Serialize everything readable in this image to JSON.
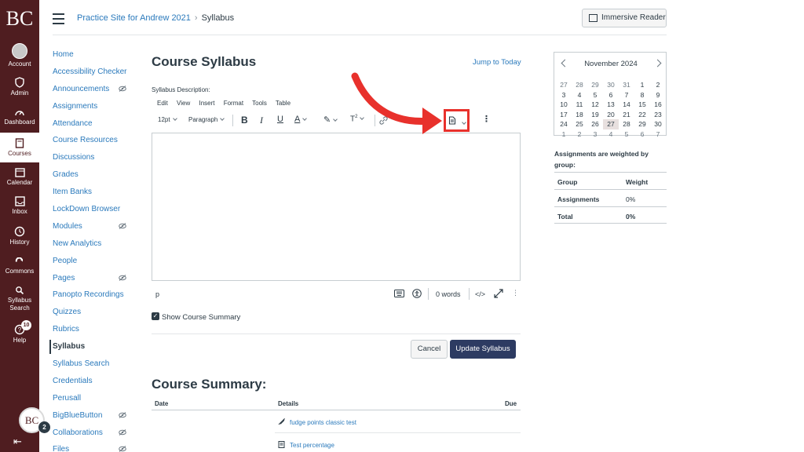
{
  "global_nav": {
    "logo": "BC",
    "items": [
      {
        "label": "Account"
      },
      {
        "label": "Admin"
      },
      {
        "label": "Dashboard"
      },
      {
        "label": "Courses"
      },
      {
        "label": "Calendar"
      },
      {
        "label": "Inbox"
      },
      {
        "label": "History"
      },
      {
        "label": "Commons"
      },
      {
        "label": "Syllabus Search"
      },
      {
        "label": "Help"
      }
    ],
    "help_badge": "10",
    "avatar_initials": "BC",
    "avatar_badge": "2"
  },
  "header": {
    "crumb_course": "Practice Site for Andrew 2021",
    "crumb_current": "Syllabus",
    "immersive_reader": "Immersive Reader"
  },
  "course_nav": [
    {
      "label": "Home"
    },
    {
      "label": "Accessibility Checker"
    },
    {
      "label": "Announcements"
    },
    {
      "label": "Assignments"
    },
    {
      "label": "Attendance"
    },
    {
      "label": "Course Resources"
    },
    {
      "label": "Discussions"
    },
    {
      "label": "Grades"
    },
    {
      "label": "Item Banks"
    },
    {
      "label": "LockDown Browser"
    },
    {
      "label": "Modules"
    },
    {
      "label": "New Analytics"
    },
    {
      "label": "People"
    },
    {
      "label": "Pages"
    },
    {
      "label": "Panopto Recordings"
    },
    {
      "label": "Quizzes"
    },
    {
      "label": "Rubrics"
    },
    {
      "label": "Syllabus"
    },
    {
      "label": "Syllabus Search"
    },
    {
      "label": "Credentials"
    },
    {
      "label": "Perusall"
    },
    {
      "label": "BigBlueButton"
    },
    {
      "label": "Collaborations"
    },
    {
      "label": "Files"
    }
  ],
  "main": {
    "title": "Course Syllabus",
    "jump_link": "Jump to Today",
    "description_label": "Syllabus Description:",
    "menubar": [
      "Edit",
      "View",
      "Insert",
      "Format",
      "Tools",
      "Table"
    ],
    "font_size": "12pt",
    "block_format": "Paragraph",
    "status_path": "p",
    "word_count": "0 words",
    "html_toggle": "</>",
    "show_summary_label": "Show Course Summary",
    "cancel_label": "Cancel",
    "update_label": "Update Syllabus",
    "summary_title": "Course Summary:",
    "summary_headers": {
      "date": "Date",
      "details": "Details",
      "due": "Due"
    },
    "summary_rows": [
      {
        "title": "fudge points classic test"
      },
      {
        "title": "Test percentage"
      }
    ]
  },
  "calendar": {
    "title": "November 2024",
    "weeks": [
      [
        "27",
        "28",
        "29",
        "30",
        "31",
        "1",
        "2"
      ],
      [
        "3",
        "4",
        "5",
        "6",
        "7",
        "8",
        "9"
      ],
      [
        "10",
        "11",
        "12",
        "13",
        "14",
        "15",
        "16"
      ],
      [
        "17",
        "18",
        "19",
        "20",
        "21",
        "22",
        "23"
      ],
      [
        "24",
        "25",
        "26",
        "27",
        "28",
        "29",
        "30"
      ],
      [
        "1",
        "2",
        "3",
        "4",
        "5",
        "6",
        "7"
      ]
    ]
  },
  "weights": {
    "title": "Assignments are weighted by group:",
    "header_group": "Group",
    "header_weight": "Weight",
    "rows": [
      {
        "group": "Assignments",
        "weight": "0%"
      },
      {
        "group": "Total",
        "weight": "0%"
      }
    ]
  },
  "colors": {
    "nav_bg": "#4f1d20",
    "link": "#2b7abc",
    "primary_button": "#2d3b62",
    "annotation": "#e8312c"
  }
}
